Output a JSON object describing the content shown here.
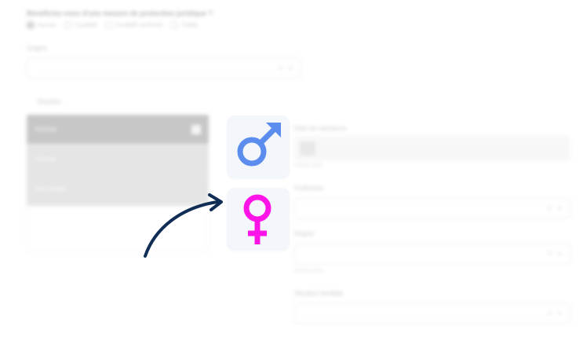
{
  "form": {
    "question": "Bénéficiez-vous d'une mesure de protection juridique ?",
    "radio_options": [
      {
        "label": "Aucune",
        "checked": true
      },
      {
        "label": "Curatelle",
        "checked": false
      },
      {
        "label": "Curatelle renforcée",
        "checked": false
      },
      {
        "label": "Tutelle",
        "checked": false
      }
    ],
    "origine_label": "Origine",
    "origine_value": "",
    "situation_label": "Situation",
    "situation_options": [
      "Homme",
      "Femme",
      "Non binaire"
    ],
    "situation_selected": "Homme",
    "photo_label": "Date de naissance",
    "photo_hint": "Champ requis",
    "profession_label": "Profession",
    "region_label": "Région",
    "region_hint": "Champ requis",
    "family_label": "Situation familiale"
  },
  "overlay": {
    "male_icon": "male-symbol-icon",
    "female_icon": "female-symbol-icon",
    "male_color": "#5b8def",
    "female_color": "#ff14e8",
    "arrow_color": "#0f2d55"
  }
}
